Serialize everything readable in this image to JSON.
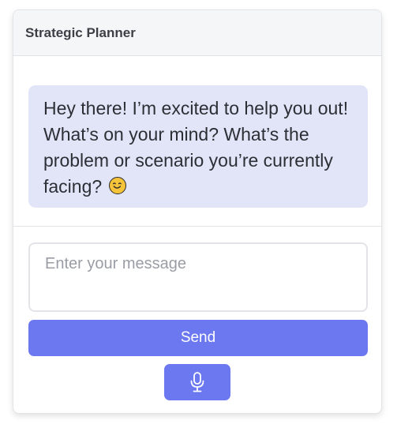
{
  "header": {
    "title": "Strategic Planner"
  },
  "messages": [
    {
      "role": "assistant",
      "text": "Hey there! I’m excited to help you out! What’s on your mind? What’s the problem or scenario you’re currently facing?",
      "emoji_icon": "smiling-face-emoji-icon"
    }
  ],
  "composer": {
    "input_value": "",
    "placeholder": "Enter your message",
    "send_label": "Send",
    "mic_icon": "microphone-icon"
  },
  "colors": {
    "accent": "#6b78ef",
    "bubble_background": "#e1e5f7",
    "header_background": "#f5f6f8"
  }
}
